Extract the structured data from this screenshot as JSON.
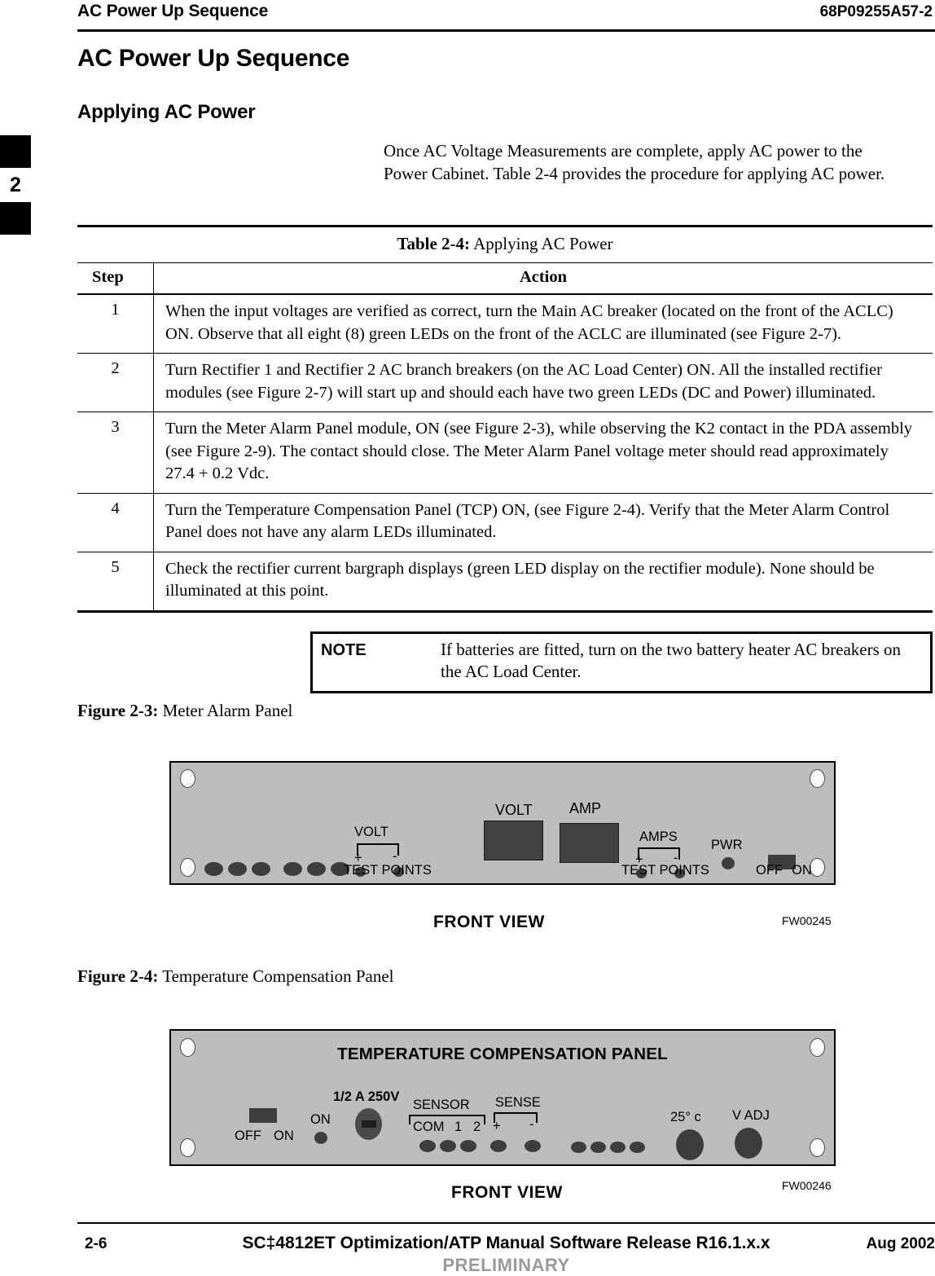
{
  "header": {
    "running_title": "AC Power Up Sequence",
    "doc_number": "68P09255A57-2"
  },
  "chapter_tab": {
    "number": "2"
  },
  "page_title": "AC Power Up Sequence",
  "section_title": "Applying AC Power",
  "intro_paragraph": "Once AC Voltage Measurements are complete, apply AC power to the Power Cabinet. Table 2-4 provides the procedure for applying AC power.",
  "table": {
    "caption_label": "Table 2-4:",
    "caption_text": " Applying AC Power",
    "columns": {
      "step": "Step",
      "action": "Action"
    },
    "rows": [
      {
        "step": "1",
        "action": "When the input voltages are verified as correct, turn the Main AC breaker (located on the front of the ACLC) ON. Observe that all eight (8) green LEDs on the front of the ACLC are illuminated (see Figure 2-7)."
      },
      {
        "step": "2",
        "action": "Turn Rectifier 1 and Rectifier 2 AC branch breakers (on the AC Load Center) ON. All the installed rectifier modules (see Figure 2-7) will start up and should each have two green LEDs (DC and Power) illuminated."
      },
      {
        "step": "3",
        "action": "Turn the Meter Alarm Panel  module, ON (see Figure 2-3), while observing the K2 contact in the PDA assembly (see Figure 2-9). The contact should close. The Meter Alarm Panel voltage meter should read approximately 27.4 + 0.2 Vdc."
      },
      {
        "step": "4",
        "action": "Turn the Temperature Compensation Panel (TCP)  ON, (see Figure 2-4). Verify that the Meter Alarm Control Panel does not have any alarm LEDs illuminated."
      },
      {
        "step": "5",
        "action": "Check the rectifier current bargraph displays (green LED display on the rectifier module). None should be illuminated at this point."
      }
    ]
  },
  "note": {
    "label": "NOTE",
    "text": "If batteries are fitted, turn on the two battery heater AC breakers on the AC Load Center."
  },
  "figures": [
    {
      "caption_label": "Figure 2-3:",
      "caption_text": " Meter Alarm Panel",
      "view_label": "FRONT VIEW",
      "drawing_id": "FW00245",
      "labels": {
        "volt_meter": "VOLT",
        "amp_meter": "AMP",
        "volt_testpoints_group": "VOLT",
        "volt_plus": "+",
        "volt_minus": "-",
        "volt_testpoints": "TEST POINTS",
        "amps_testpoints_group": "AMPS",
        "amps_plus": "+",
        "amps_minus": "-",
        "amps_testpoints": "TEST POINTS",
        "power_led": "PWR",
        "switch_off": "OFF",
        "switch_on": "ON"
      }
    },
    {
      "caption_label": "Figure 2-4:",
      "caption_text": " Temperature Compensation Panel",
      "view_label": "FRONT VIEW",
      "drawing_id": "FW00246",
      "panel_title": "TEMPERATURE COMPENSATION PANEL",
      "labels": {
        "switch_off": "OFF",
        "switch_on": "ON",
        "on_led": "ON",
        "fuse_rating": "1/2 A 250V",
        "sensor_group": "SENSOR",
        "sensor_com": "COM",
        "sensor_1": "1",
        "sensor_2": "2",
        "sense_group": "SENSE",
        "sense_plus": "+",
        "sense_minus": "-",
        "temp_knob": "25° c",
        "vadj_knob": "V ADJ"
      }
    }
  ],
  "footer": {
    "page_number": "2-6",
    "manual_title": "SC‡4812ET Optimization/ATP Manual Software Release R16.1.x.x",
    "date": "Aug 2002",
    "status": "PRELIMINARY"
  },
  "colors": {
    "panel_face": "#bdbdbd",
    "component_dark": "#3d3d3d",
    "meter_dark": "#414141",
    "prelim_grey": "#9a9a9a"
  }
}
